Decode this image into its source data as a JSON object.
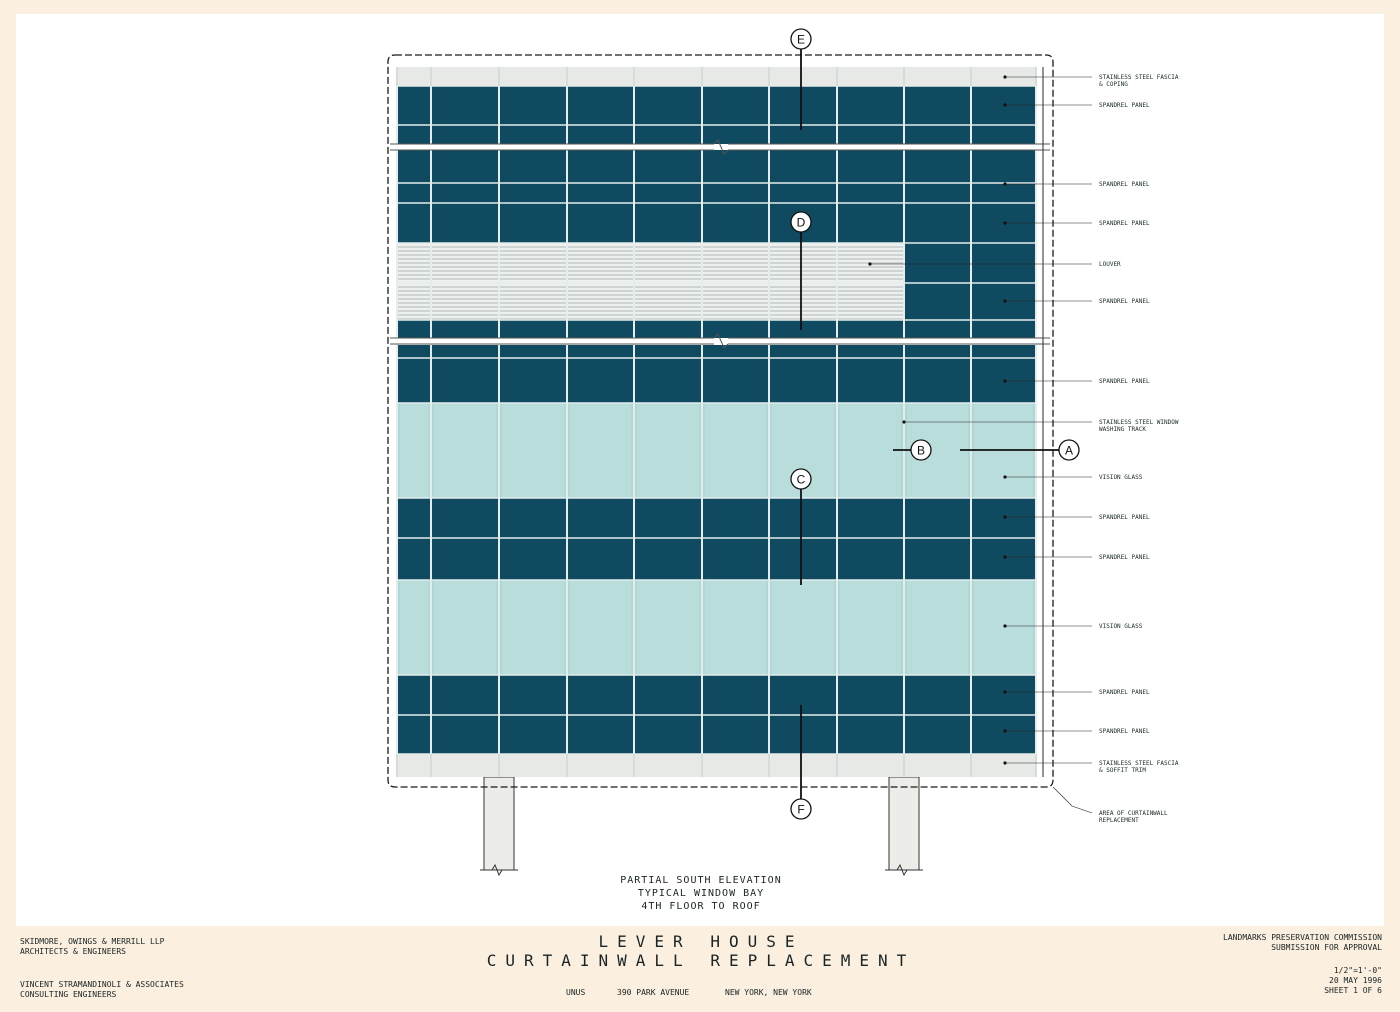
{
  "drawing": {
    "caption": [
      "PARTIAL SOUTH ELEVATION",
      "TYPICAL WINDOW BAY",
      "4TH FLOOR TO ROOF"
    ],
    "bubbles": {
      "a": "A",
      "b": "B",
      "c": "C",
      "d": "D",
      "e": "E",
      "f": "F"
    },
    "labels": {
      "fascia_coping": [
        "STAINLESS STEEL FASCIA",
        "& COPING"
      ],
      "spandrel_1": "SPANDREL PANEL",
      "spandrel_2": "SPANDREL PANEL",
      "spandrel_3": "SPANDREL PANEL",
      "louver": "LOUVER",
      "spandrel_4": "SPANDREL PANEL",
      "spandrel_5": "SPANDREL PANEL",
      "track": [
        "STAINLESS STEEL WINDOW",
        "WASHING TRACK"
      ],
      "vision_1": "VISION GLASS",
      "spandrel_6": "SPANDREL PANEL",
      "spandrel_7": "SPANDREL PANEL",
      "vision_2": "VISION GLASS",
      "spandrel_8": "SPANDREL PANEL",
      "spandrel_9": "SPANDREL PANEL",
      "fascia_soffit": [
        "STAINLESS STEEL FASCIA",
        "& SOFFIT TRIM"
      ],
      "area": [
        "AREA OF CURTAINWALL",
        "REPLACEMENT"
      ]
    },
    "colors": {
      "spandrel": "#0f4a60",
      "vision": "#aed7d6",
      "fascia": "#e7e9e7",
      "sheet": "#fbefe0",
      "paper": "#ffffff"
    }
  },
  "title_block": {
    "firm": [
      "SKIDMORE, OWINGS & MERRILL  LLP",
      "ARCHITECTS & ENGINEERS"
    ],
    "engineer": [
      "VINCENT STRAMANDINOLI & ASSOCIATES",
      "CONSULTING ENGINEERS"
    ],
    "project_line1": "LEVER  HOUSE",
    "project_line2": "CURTAINWALL  REPLACEMENT",
    "client": "UNUS",
    "address": "390 PARK AVENUE",
    "city": "NEW YORK, NEW YORK",
    "submission": [
      "LANDMARKS PRESERVATION COMMISSION",
      "SUBMISSION FOR APPROVAL"
    ],
    "scale": "1/2\"=1'-0\"",
    "date": "20 MAY 1996",
    "sheet": "SHEET 1 OF 6"
  }
}
